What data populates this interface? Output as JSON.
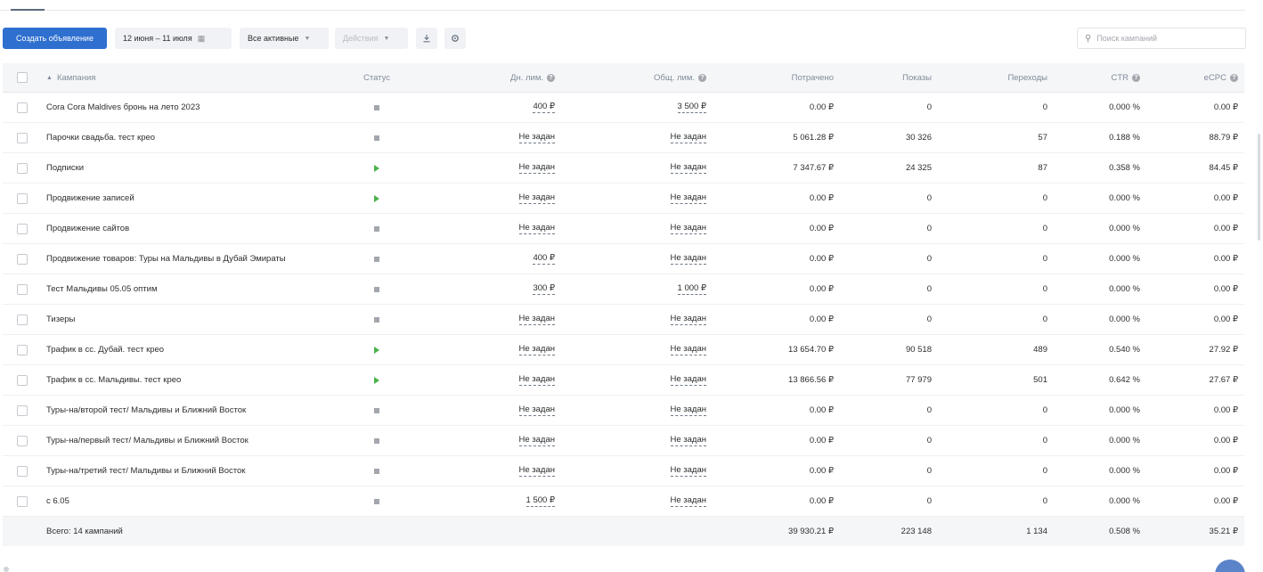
{
  "toolbar": {
    "create_label": "Создать объявление",
    "date_range": "12 июня – 11 июля",
    "status_filter": "Все активные",
    "actions_label": "Действия",
    "search_placeholder": "Поиск кампаний"
  },
  "colors": {
    "primary": "#2e6fcf",
    "active_status": "#4bb34b",
    "stopped_status": "#a3a7ad"
  },
  "icons": {
    "calendar": "calendar-icon",
    "export": "download-icon",
    "settings": "gear-icon",
    "search": "search-icon",
    "info": "info-icon",
    "play": "play-icon",
    "stop": "stop-icon"
  },
  "table": {
    "headers": {
      "campaign": "Кампания",
      "status": "Статус",
      "day_limit": "Дн. лим.",
      "total_limit": "Общ. лим.",
      "spent": "Потрачено",
      "shows": "Показы",
      "clicks": "Переходы",
      "ctr": "CTR",
      "ecpc": "eCPC"
    },
    "rows": [
      {
        "name": "Cora Cora Maldives бронь на лето 2023",
        "status": "stopped",
        "day_limit": "400 ₽",
        "total_limit": "3 500 ₽",
        "spent": "0.00 ₽",
        "shows": "0",
        "clicks": "0",
        "ctr": "0.000 %",
        "ecpc": "0.00 ₽"
      },
      {
        "name": "Парочки свадьба. тест крео",
        "status": "stopped",
        "day_limit": "Не задан",
        "total_limit": "Не задан",
        "spent": "5 061.28 ₽",
        "shows": "30 326",
        "clicks": "57",
        "ctr": "0.188 %",
        "ecpc": "88.79 ₽"
      },
      {
        "name": "Подписки",
        "status": "active",
        "day_limit": "Не задан",
        "total_limit": "Не задан",
        "spent": "7 347.67 ₽",
        "shows": "24 325",
        "clicks": "87",
        "ctr": "0.358 %",
        "ecpc": "84.45 ₽"
      },
      {
        "name": "Продвижение записей",
        "status": "active",
        "day_limit": "Не задан",
        "total_limit": "Не задан",
        "spent": "0.00 ₽",
        "shows": "0",
        "clicks": "0",
        "ctr": "0.000 %",
        "ecpc": "0.00 ₽"
      },
      {
        "name": "Продвижение сайтов",
        "status": "stopped",
        "day_limit": "Не задан",
        "total_limit": "Не задан",
        "spent": "0.00 ₽",
        "shows": "0",
        "clicks": "0",
        "ctr": "0.000 %",
        "ecpc": "0.00 ₽"
      },
      {
        "name": "Продвижение товаров: Туры на Мальдивы в Дубай Эмираты",
        "status": "stopped",
        "day_limit": "400 ₽",
        "total_limit": "Не задан",
        "spent": "0.00 ₽",
        "shows": "0",
        "clicks": "0",
        "ctr": "0.000 %",
        "ecpc": "0.00 ₽"
      },
      {
        "name": "Тест Мальдивы 05.05 оптим",
        "status": "stopped",
        "day_limit": "300 ₽",
        "total_limit": "1 000 ₽",
        "spent": "0.00 ₽",
        "shows": "0",
        "clicks": "0",
        "ctr": "0.000 %",
        "ecpc": "0.00 ₽"
      },
      {
        "name": "Тизеры",
        "status": "stopped",
        "day_limit": "Не задан",
        "total_limit": "Не задан",
        "spent": "0.00 ₽",
        "shows": "0",
        "clicks": "0",
        "ctr": "0.000 %",
        "ecpc": "0.00 ₽"
      },
      {
        "name": "Трафик в сс. Дубай. тест крео",
        "status": "active",
        "day_limit": "Не задан",
        "total_limit": "Не задан",
        "spent": "13 654.70 ₽",
        "shows": "90 518",
        "clicks": "489",
        "ctr": "0.540 %",
        "ecpc": "27.92 ₽"
      },
      {
        "name": "Трафик в сс. Мальдивы. тест крео",
        "status": "active",
        "day_limit": "Не задан",
        "total_limit": "Не задан",
        "spent": "13 866.56 ₽",
        "shows": "77 979",
        "clicks": "501",
        "ctr": "0.642 %",
        "ecpc": "27.67 ₽"
      },
      {
        "name": "Туры-на/второй тест/ Мальдивы и Ближний Восток",
        "status": "stopped",
        "day_limit": "Не задан",
        "total_limit": "Не задан",
        "spent": "0.00 ₽",
        "shows": "0",
        "clicks": "0",
        "ctr": "0.000 %",
        "ecpc": "0.00 ₽"
      },
      {
        "name": "Туры-на/первый тест/ Мальдивы и Ближний Восток",
        "status": "stopped",
        "day_limit": "Не задан",
        "total_limit": "Не задан",
        "spent": "0.00 ₽",
        "shows": "0",
        "clicks": "0",
        "ctr": "0.000 %",
        "ecpc": "0.00 ₽"
      },
      {
        "name": "Туры-на/третий тест/ Мальдивы и Ближний Восток",
        "status": "stopped",
        "day_limit": "Не задан",
        "total_limit": "Не задан",
        "spent": "0.00 ₽",
        "shows": "0",
        "clicks": "0",
        "ctr": "0.000 %",
        "ecpc": "0.00 ₽"
      },
      {
        "name": "с 6.05",
        "status": "stopped",
        "day_limit": "1 500 ₽",
        "total_limit": "Не задан",
        "spent": "0.00 ₽",
        "shows": "0",
        "clicks": "0",
        "ctr": "0.000 %",
        "ecpc": "0.00 ₽"
      }
    ],
    "total": {
      "label": "Всего: 14 кампаний",
      "spent": "39 930.21 ₽",
      "shows": "223 148",
      "clicks": "1 134",
      "ctr": "0.508 %",
      "ecpc": "35.21 ₽"
    }
  }
}
